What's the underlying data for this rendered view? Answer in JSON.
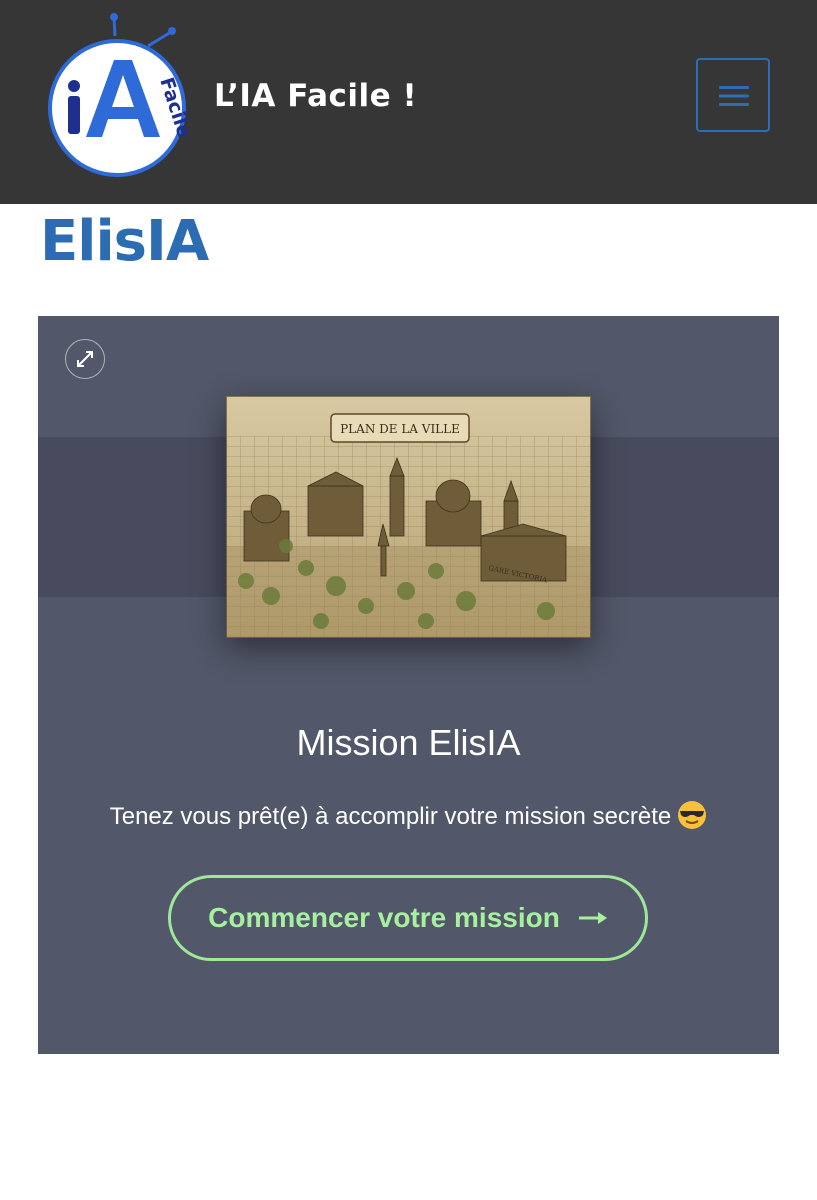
{
  "header": {
    "logo_text": "iA",
    "logo_subtext": "Facile",
    "site_title": "L’IA Facile !",
    "menu_icon": "hamburger-menu-icon"
  },
  "page": {
    "title": "ElisIA"
  },
  "card": {
    "expand_icon": "expand-icon",
    "image_caption": "PLAN DE LA VILLE",
    "image_label": "GARE VICTORIA",
    "mission_title": "Mission ElisIA",
    "mission_text": "Tenez vous prêt(e) à accomplir votre mission secrète",
    "mission_emoji": "sunglasses-emoji-icon",
    "cta_label": "Commencer votre mission",
    "cta_icon": "arrow-right-icon"
  },
  "colors": {
    "header_bg": "#363636",
    "title_blue": "#2b6cb3",
    "panel_bg": "#525769",
    "cta_green": "#9ee89a"
  }
}
